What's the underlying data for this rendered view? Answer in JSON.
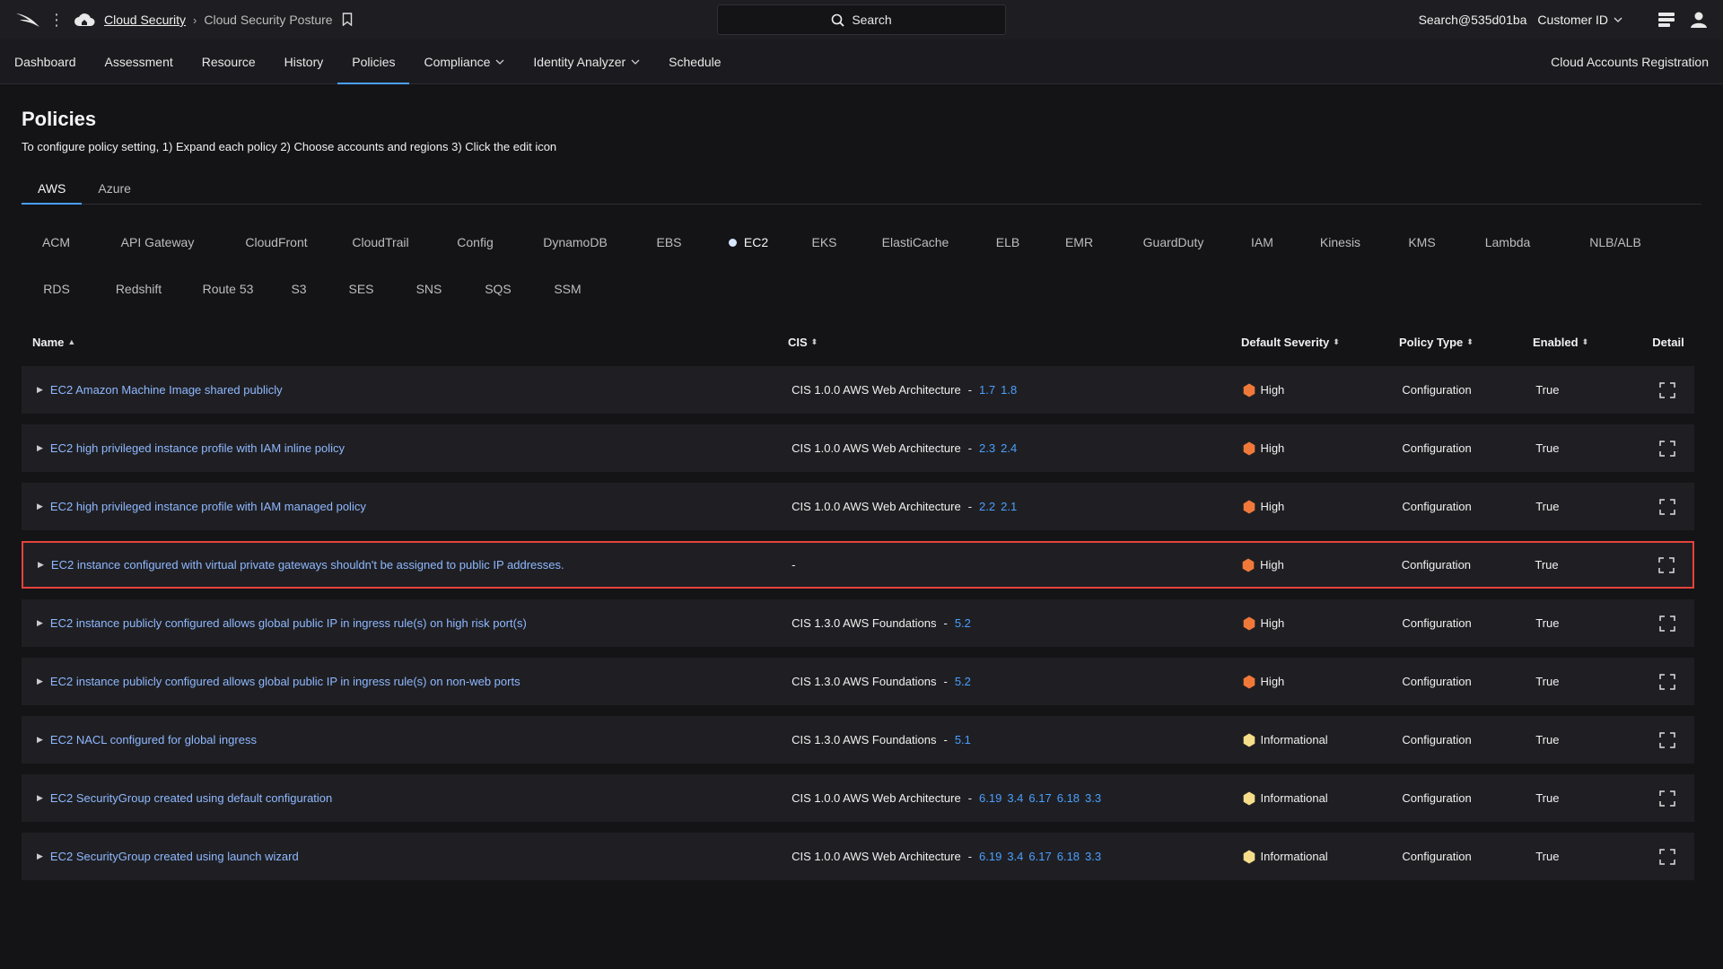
{
  "topbar": {
    "breadcrumb_app": "Cloud Security",
    "breadcrumb_page": "Cloud Security Posture",
    "search_label": "Search",
    "user": "Search@535d01ba",
    "customer": "Customer ID"
  },
  "nav": {
    "items": [
      {
        "label": "Dashboard"
      },
      {
        "label": "Assessment"
      },
      {
        "label": "Resource"
      },
      {
        "label": "History"
      },
      {
        "label": "Policies"
      },
      {
        "label": "Compliance"
      },
      {
        "label": "Identity Analyzer"
      },
      {
        "label": "Schedule"
      }
    ],
    "right_link": "Cloud Accounts Registration"
  },
  "page": {
    "title": "Policies",
    "description": "To configure policy setting, 1) Expand each policy 2) Choose accounts and regions 3) Click the edit icon"
  },
  "provider_tabs": [
    "AWS",
    "Azure"
  ],
  "services": [
    "ACM",
    "API Gateway",
    "CloudFront",
    "CloudTrail",
    "Config",
    "DynamoDB",
    "EBS",
    "EC2",
    "EKS",
    "ElastiCache",
    "ELB",
    "EMR",
    "GuardDuty",
    "IAM",
    "Kinesis",
    "KMS",
    "Lambda",
    "NLB/ALB",
    "RDS",
    "Redshift",
    "Route 53",
    "S3",
    "SES",
    "SNS",
    "SQS",
    "SSM"
  ],
  "table": {
    "headers": {
      "name": "Name",
      "cis": "CIS",
      "severity": "Default Severity",
      "type": "Policy Type",
      "enabled": "Enabled",
      "detail": "Detail"
    },
    "rows": [
      {
        "name": "EC2 Amazon Machine Image shared publicly",
        "cis": "CIS 1.0.0 AWS Web Architecture",
        "sep": "-",
        "refs": [
          "1.7",
          "1.8"
        ],
        "severity": "High",
        "type": "Configuration",
        "enabled": "True"
      },
      {
        "name": "EC2 high privileged instance profile with IAM inline policy",
        "cis": "CIS 1.0.0 AWS Web Architecture",
        "sep": "-",
        "refs": [
          "2.3",
          "2.4"
        ],
        "severity": "High",
        "type": "Configuration",
        "enabled": "True"
      },
      {
        "name": "EC2 high privileged instance profile with IAM managed policy",
        "cis": "CIS 1.0.0 AWS Web Architecture",
        "sep": "-",
        "refs": [
          "2.2",
          "2.1"
        ],
        "severity": "High",
        "type": "Configuration",
        "enabled": "True"
      },
      {
        "name": "EC2 instance configured with virtual private gateways shouldn't be assigned to public IP addresses.",
        "cis": "",
        "sep": "-",
        "refs": [],
        "severity": "High",
        "type": "Configuration",
        "enabled": "True"
      },
      {
        "name": "EC2 instance publicly configured allows global public IP in ingress rule(s) on high risk port(s)",
        "cis": "CIS 1.3.0 AWS Foundations",
        "sep": "-",
        "refs": [
          "5.2"
        ],
        "severity": "High",
        "type": "Configuration",
        "enabled": "True"
      },
      {
        "name": "EC2 instance publicly configured allows global public IP in ingress rule(s) on non-web ports",
        "cis": "CIS 1.3.0 AWS Foundations",
        "sep": "-",
        "refs": [
          "5.2"
        ],
        "severity": "High",
        "type": "Configuration",
        "enabled": "True"
      },
      {
        "name": "EC2 NACL configured for global ingress",
        "cis": "CIS 1.3.0 AWS Foundations",
        "sep": "-",
        "refs": [
          "5.1"
        ],
        "severity": "Informational",
        "type": "Configuration",
        "enabled": "True"
      },
      {
        "name": "EC2 SecurityGroup created using default configuration",
        "cis": "CIS 1.0.0 AWS Web Architecture",
        "sep": "-",
        "refs": [
          "6.19",
          "3.4",
          "6.17",
          "6.18",
          "3.3"
        ],
        "severity": "Informational",
        "type": "Configuration",
        "enabled": "True"
      },
      {
        "name": "EC2 SecurityGroup created using launch wizard",
        "cis": "CIS 1.0.0 AWS Web Architecture",
        "sep": "-",
        "refs": [
          "6.19",
          "3.4",
          "6.17",
          "6.18",
          "3.3"
        ],
        "severity": "Informational",
        "type": "Configuration",
        "enabled": "True"
      }
    ]
  },
  "colors": {
    "accent": "#4a9fff",
    "high": "#f0793a",
    "informational": "#f6dd8a",
    "highlight_border": "#e5423b"
  }
}
